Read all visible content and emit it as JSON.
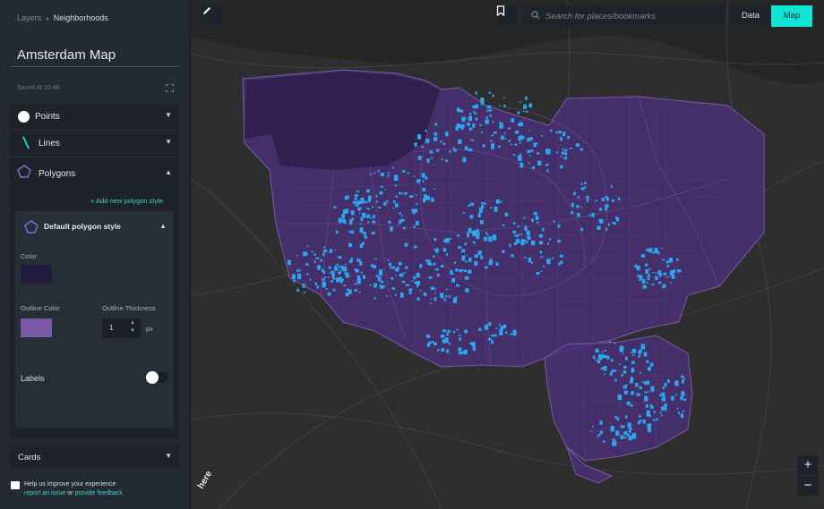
{
  "breadcrumb": {
    "parent": "Layers",
    "separator": "›",
    "current": "Neighborhoods"
  },
  "project": {
    "title": "Amsterdam Map",
    "saved_status": "Saved At 10:46"
  },
  "layers": {
    "points_label": "Points",
    "lines_label": "Lines",
    "polygons_label": "Polygons",
    "add_polygon_style": "+ Add new polygon style"
  },
  "polygon_style": {
    "name": "Default polygon style",
    "color_label": "Color",
    "color_value": "#221c3f",
    "outline_color_label": "Outline Color",
    "outline_color_value": "#7a5aa8",
    "outline_thickness_label": "Outline Thickness",
    "outline_thickness_value": "1",
    "outline_thickness_unit": "px",
    "labels_label": "Labels",
    "labels_enabled": false
  },
  "cards_label": "Cards",
  "feedback": {
    "line1": "Help us improve your experience",
    "report_link": "report an issue",
    "or_text": "or",
    "feedback_link": "provide feedback"
  },
  "toolbar": {
    "search_placeholder": "Search for places/bookmarks",
    "data_tab": "Data",
    "map_tab": "Map"
  },
  "zoom": {
    "in_label": "+",
    "out_label": "−"
  },
  "map_attribution": "here",
  "colors": {
    "accent": "#10e5d5",
    "polygon_fill": "#4a2f78",
    "point_fill": "#2aa7f0"
  }
}
